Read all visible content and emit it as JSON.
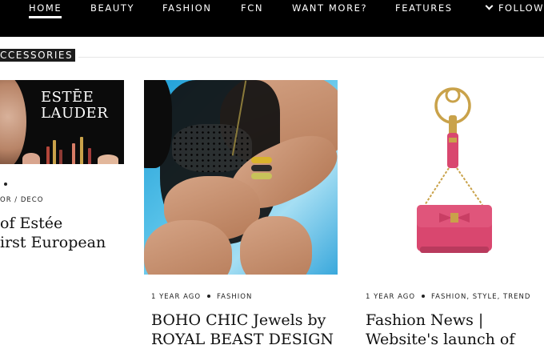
{
  "nav": {
    "items": [
      "HOME",
      "BEAUTY",
      "FASHION",
      "FCN",
      "WANT MORE?",
      "FEATURES"
    ],
    "active": "HOME",
    "follow_label": "FOLLOW"
  },
  "section": {
    "label": "CCESSORIES"
  },
  "cards": [
    {
      "brand_line1": "ESTĒE",
      "brand_line2": "LAUDER",
      "meta_partial": "OR / DECO",
      "title_line1": "of Estée",
      "title_line2": "irst European"
    },
    {
      "meta_time": "1 YEAR AGO",
      "meta_tags": "FASHION",
      "title_line1": "BOHO CHIC Jewels by",
      "title_line2": "ROYAL BEAST DESIGN"
    },
    {
      "meta_time": "1 YEAR AGO",
      "meta_tags": "FASHION, STYLE, TREND",
      "title_line1": "Fashion News |",
      "title_line2": "Website's launch of"
    }
  ],
  "colors": {
    "topbar": "#000000",
    "bag": "#d9476f",
    "hardware": "#c9a24a"
  },
  "icons": [
    "chevron-down-icon"
  ]
}
